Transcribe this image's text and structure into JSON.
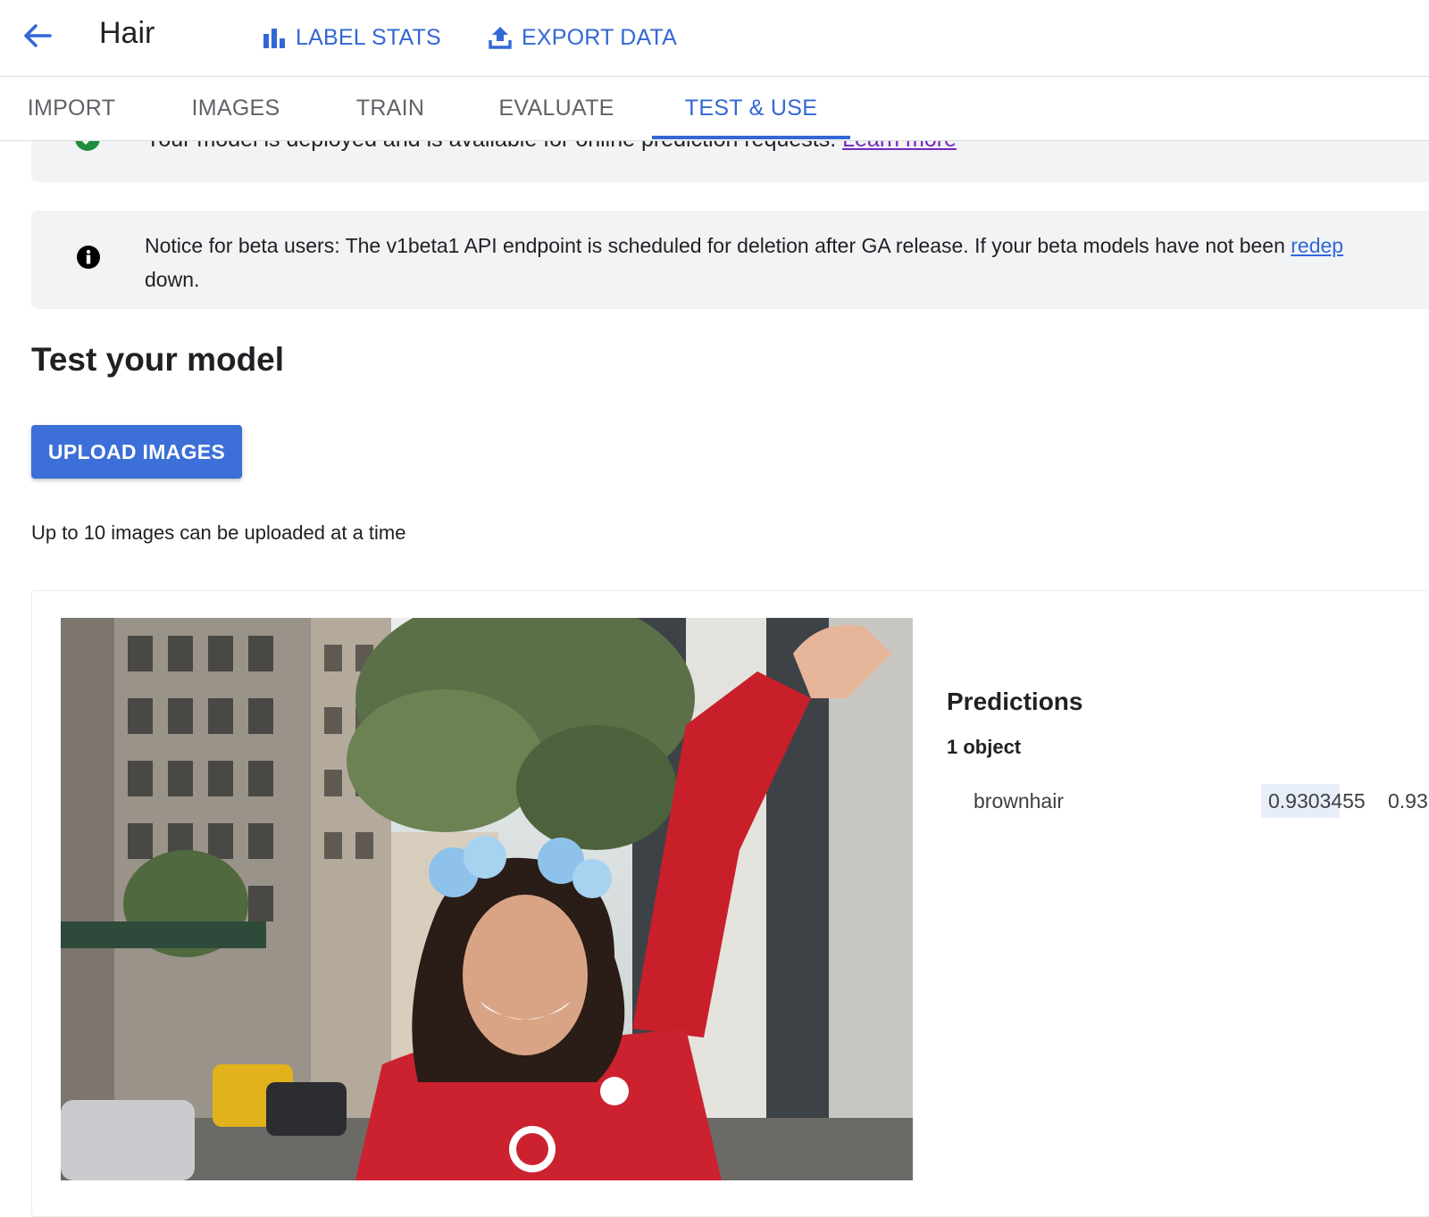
{
  "header": {
    "title": "Hair",
    "label_stats": "LABEL STATS",
    "export_data": "EXPORT DATA"
  },
  "tabs": [
    {
      "label": "IMPORT",
      "active": false
    },
    {
      "label": "IMAGES",
      "active": false
    },
    {
      "label": "TRAIN",
      "active": false
    },
    {
      "label": "EVALUATE",
      "active": false
    },
    {
      "label": "TEST & USE",
      "active": true
    }
  ],
  "deploy_banner": {
    "message": "Your model is deployed and is available for online prediction requests.",
    "link": "Learn more"
  },
  "notice": {
    "text": "Notice for beta users: The v1beta1 API endpoint is scheduled for deletion after GA release. If your beta models have not been ",
    "link": "redep",
    "continuation": "down."
  },
  "test": {
    "title": "Test your model",
    "upload_button": "UPLOAD IMAGES",
    "hint": "Up to 10 images can be uploaded at a time"
  },
  "predictions": {
    "title": "Predictions",
    "count": "1 object",
    "items": [
      {
        "label": "brownhair",
        "score": "0.9303455",
        "score_fraction": 0.93,
        "threshold_text": "0.93"
      }
    ]
  },
  "colors": {
    "accent": "#3367d6",
    "banner_bg": "#f1f3f4",
    "success": "#1e8e3e",
    "visited_link": "#7627bb"
  }
}
